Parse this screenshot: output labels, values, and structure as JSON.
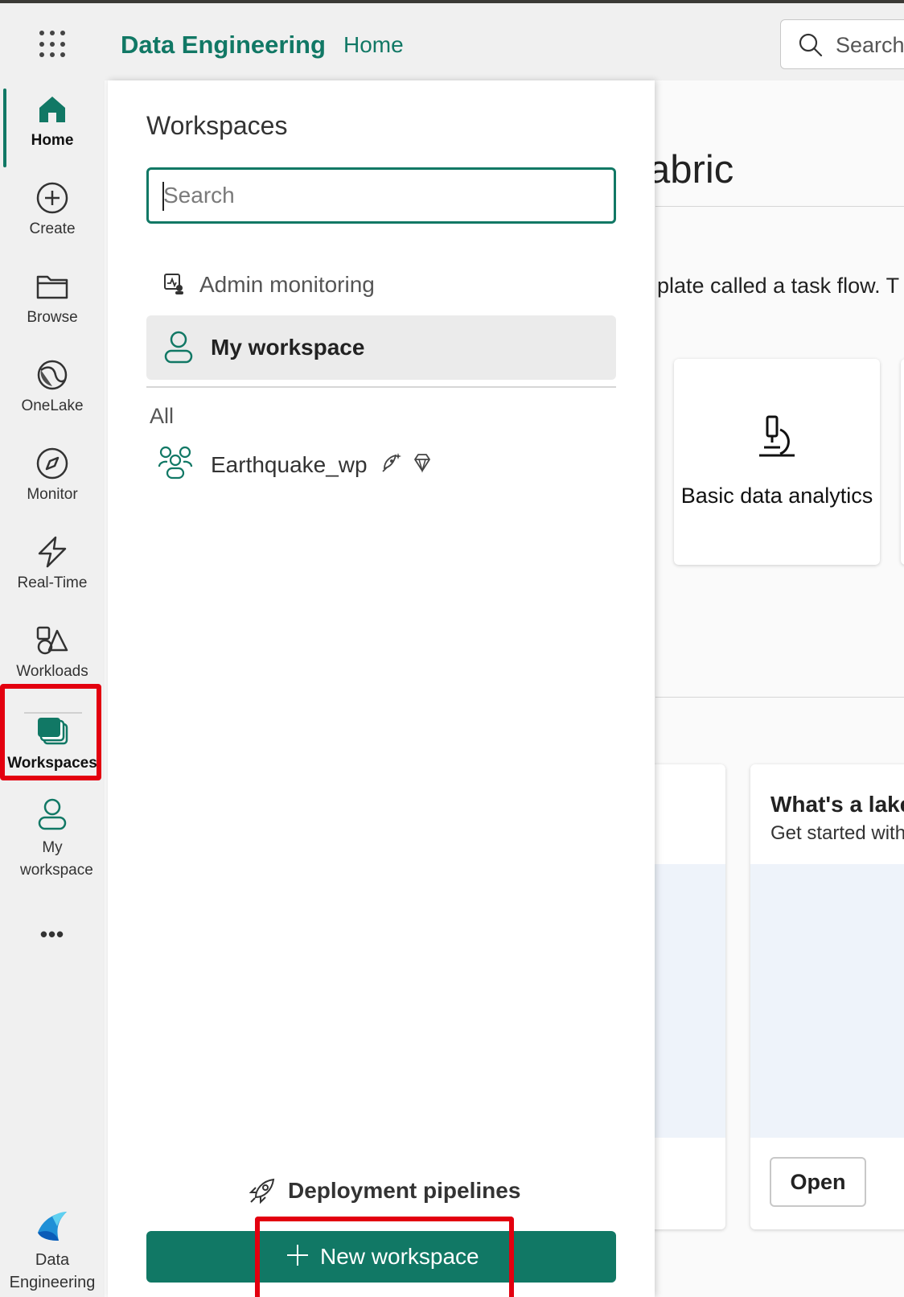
{
  "header": {
    "app_name": "Data Engineering",
    "breadcrumb": "Home",
    "search_label": "Search"
  },
  "rail": {
    "items": [
      {
        "label": "Home",
        "icon": "home-icon",
        "active": true
      },
      {
        "label": "Create",
        "icon": "add-circle-icon"
      },
      {
        "label": "Browse",
        "icon": "folder-icon"
      },
      {
        "label": "OneLake",
        "icon": "onelake-icon"
      },
      {
        "label": "Monitor",
        "icon": "compass-icon"
      },
      {
        "label": "Real-Time",
        "icon": "lightning-icon"
      },
      {
        "label": "Workloads",
        "icon": "shapes-icon"
      },
      {
        "label": "Workspaces",
        "icon": "workspaces-icon",
        "highlighted": true
      },
      {
        "label": "My workspace",
        "icon": "person-icon"
      }
    ],
    "more_label": "•••",
    "brand_label": "Data Engineering"
  },
  "panel": {
    "title": "Workspaces",
    "search_placeholder": "Search",
    "admin_monitoring": "Admin monitoring",
    "my_workspace": "My workspace",
    "all_label": "All",
    "workspaces": [
      {
        "name": "Earthquake_wp",
        "icons": [
          "people-group-icon",
          "rocket-badge-icon",
          "premium-diamond-icon"
        ]
      }
    ],
    "deployment_pipelines": "Deployment pipelines",
    "new_workspace": "New workspace"
  },
  "background": {
    "title_fragment": "abric",
    "task_text": "plate called a task flow. T",
    "basic_card": "Basic data analytics",
    "lake_card_title": "What's a lake",
    "lake_card_sub": "Get started with",
    "open_label": "Open"
  },
  "colors": {
    "accent": "#117865",
    "highlight": "#e3000f"
  }
}
